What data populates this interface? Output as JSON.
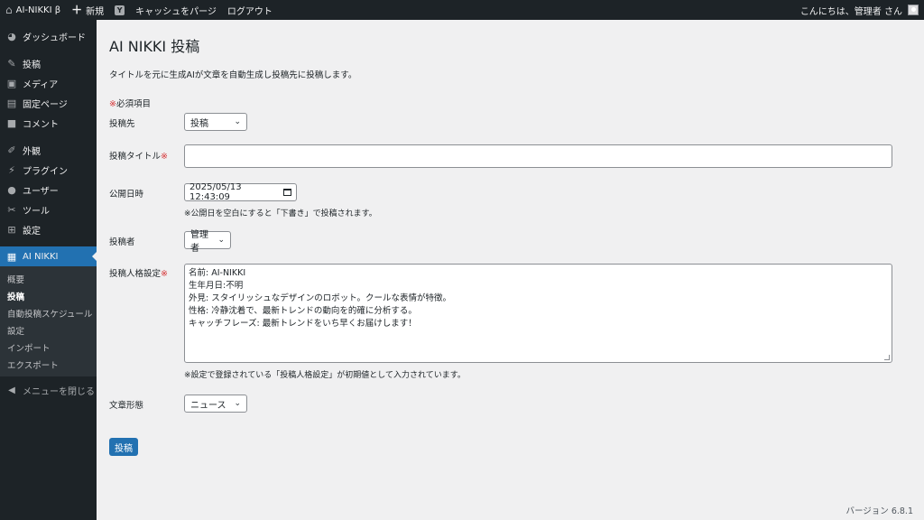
{
  "adminbar": {
    "site_name": "AI-NIKKI β",
    "new_label": "新規",
    "purge_label": "キャッシュをパージ",
    "logout_label": "ログアウト",
    "greeting": "こんにちは、管理者 さん"
  },
  "sidebar": {
    "items": [
      {
        "label": "ダッシュボード",
        "icon": "dashboard-icon"
      },
      {
        "label": "投稿",
        "icon": "pin-icon"
      },
      {
        "label": "メディア",
        "icon": "media-icon"
      },
      {
        "label": "固定ページ",
        "icon": "page-icon"
      },
      {
        "label": "コメント",
        "icon": "comment-icon"
      },
      {
        "label": "外観",
        "icon": "brush-icon"
      },
      {
        "label": "プラグイン",
        "icon": "plugin-icon"
      },
      {
        "label": "ユーザー",
        "icon": "user-icon"
      },
      {
        "label": "ツール",
        "icon": "wrench-icon"
      },
      {
        "label": "設定",
        "icon": "settings-icon"
      }
    ],
    "current": {
      "label": "AI NIKKI",
      "icon": "book-icon"
    },
    "submenu": [
      "概要",
      "投稿",
      "自動投稿スケジュール",
      "設定",
      "インポート",
      "エクスポート"
    ],
    "collapse_label": "メニューを閉じる"
  },
  "page": {
    "title": "AI NIKKI 投稿",
    "description": "タイトルを元に生成AIが文章を自動生成し投稿先に投稿します。",
    "required_mark": "※",
    "required_note": "必須項目"
  },
  "form": {
    "post_target": {
      "label": "投稿先",
      "value": "投稿"
    },
    "post_title": {
      "label": "投稿タイトル",
      "value": ""
    },
    "publish_date": {
      "label": "公開日時",
      "value": "2025/05/13 12:43:09",
      "hint": "※公開日を空白にすると「下書き」で投稿されます。"
    },
    "author": {
      "label": "投稿者",
      "value": "管理者"
    },
    "persona": {
      "label": "投稿人格設定",
      "lines": [
        "名前: AI-NIKKI",
        "生年月日:不明",
        "外見: スタイリッシュなデザインのロボット。クールな表情が特徴。",
        "性格: 冷静沈着で、最新トレンドの動向を的確に分析する。",
        "キャッチフレーズ: 最新トレンドをいち早くお届けします！"
      ],
      "hint": "※設定で登録されている「投稿人格設定」が初期値として入力されています。"
    },
    "style": {
      "label": "文章形態",
      "value": "ニュース"
    },
    "submit_label": "投稿"
  },
  "footer": {
    "version": "バージョン 6.8.1"
  }
}
